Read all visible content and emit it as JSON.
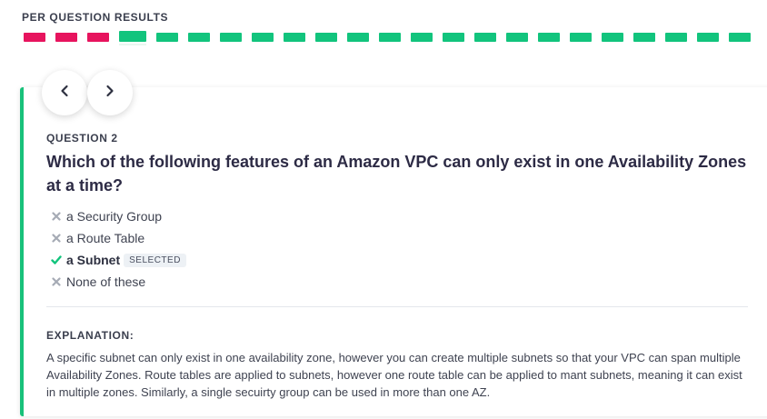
{
  "results": {
    "title": "PER QUESTION RESULTS",
    "segments": [
      "wrong",
      "wrong",
      "wrong",
      "current",
      "correct",
      "correct",
      "correct",
      "correct",
      "correct",
      "correct",
      "correct",
      "correct",
      "correct",
      "correct",
      "correct",
      "correct",
      "correct",
      "correct",
      "correct",
      "correct",
      "correct",
      "correct",
      "correct"
    ],
    "colors": {
      "correct": "#12c47d",
      "wrong": "#e7145e"
    }
  },
  "nav": {
    "prev_icon": "chevron-left-icon",
    "next_icon": "chevron-right-icon"
  },
  "question": {
    "label": "QUESTION 2",
    "text": "Which of the following features of an Amazon VPC can only exist in one Availability Zones at a time?",
    "answers": [
      {
        "label": "a Security Group",
        "status": "incorrect",
        "icon": "x-icon"
      },
      {
        "label": "a Route Table",
        "status": "incorrect",
        "icon": "x-icon"
      },
      {
        "label": "a Subnet",
        "status": "correct",
        "icon": "check-icon",
        "badge": "SELECTED"
      },
      {
        "label": "None of these",
        "status": "incorrect",
        "icon": "x-icon"
      }
    ]
  },
  "explanation": {
    "title": "EXPLANATION:",
    "text": "A specific subnet can only exist in one availability zone, however you can create multiple subnets so that your VPC can span multiple Availability Zones. Route tables are applied to subnets, however one route table can be applied to mant subnets, meaning it can exist in multiple zones. Similarly, a single secuirty group can be used in more than one AZ."
  }
}
